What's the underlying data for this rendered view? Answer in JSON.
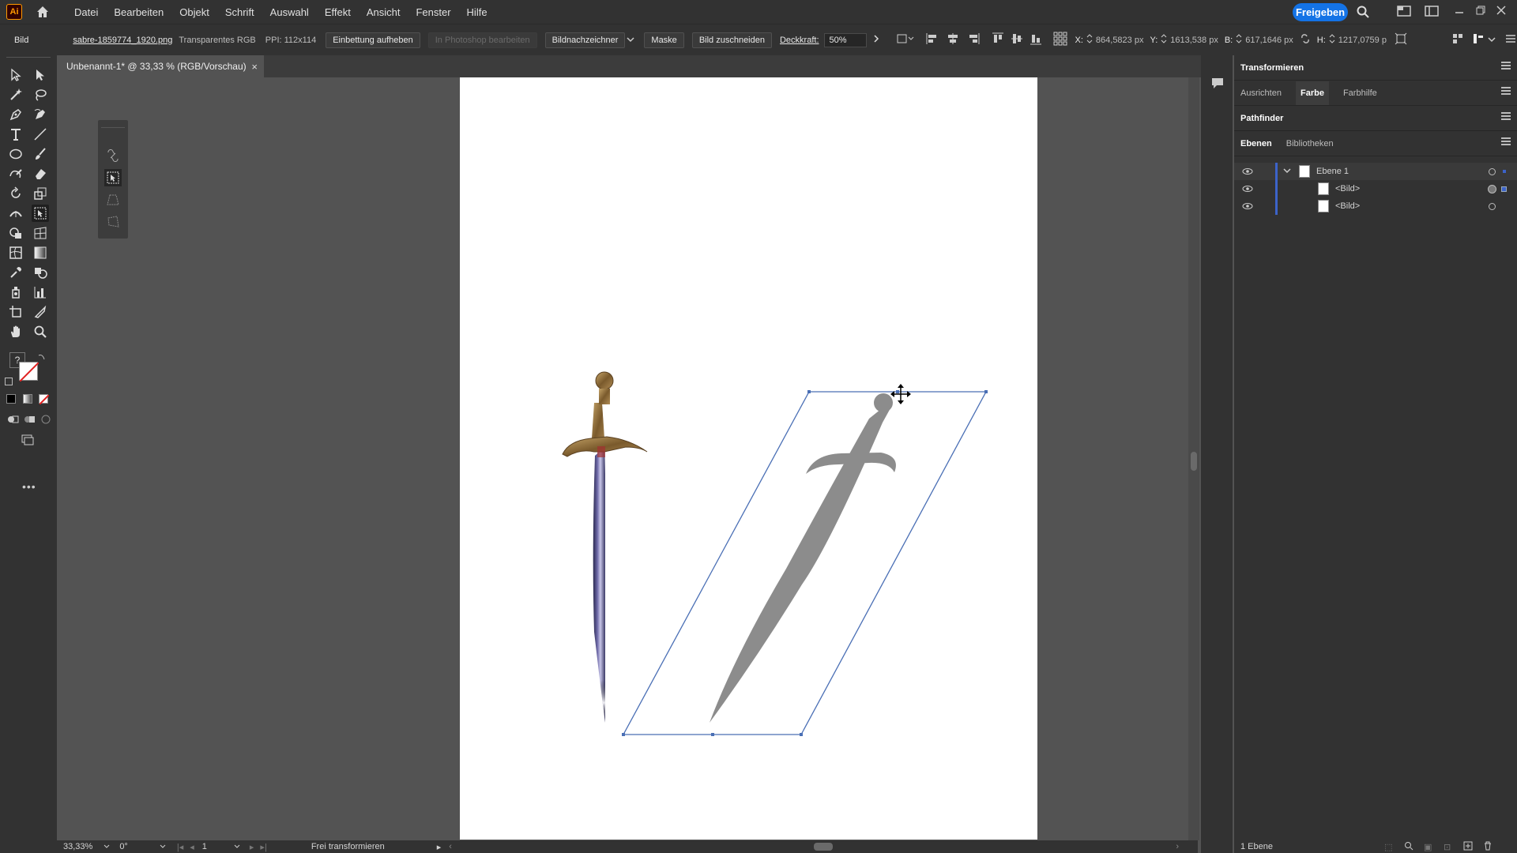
{
  "app": {
    "logo": "Ai"
  },
  "menu": [
    "Datei",
    "Bearbeiten",
    "Objekt",
    "Schrift",
    "Auswahl",
    "Effekt",
    "Ansicht",
    "Fenster",
    "Hilfe"
  ],
  "share_label": "Freigeben",
  "control": {
    "object_type": "Bild",
    "filename": "sabre-1859774_1920.png",
    "color_mode": "Transparentes RGB",
    "ppi": "PPI: 112x114",
    "unembed": "Einbettung aufheben",
    "edit_photoshop": "In Photoshop bearbeiten",
    "image_trace": "Bildnachzeichner",
    "mask": "Maske",
    "crop": "Bild zuschneiden",
    "opacity_label": "Deckkraft:",
    "opacity_value": "50%",
    "x_label": "X:",
    "x_value": "864,5823 px",
    "y_label": "Y:",
    "y_value": "1613,538 px",
    "w_label": "B:",
    "w_value": "617,1646 px",
    "h_label": "H:",
    "h_value": "1217,0759 p"
  },
  "document": {
    "tab_title": "Unbenannt-1* @ 33,33 % (RGB/Vorschau)",
    "close": "×"
  },
  "status": {
    "zoom": "33,33%",
    "rotation": "0°",
    "artboard": "1",
    "tool": "Frei transformieren"
  },
  "panels": {
    "transform_title": "Transformieren",
    "row2_tabs": [
      "Ausrichten",
      "Farbe",
      "Farbhilfe"
    ],
    "pathfinder": "Pathfinder",
    "layers_tabs": [
      "Ebenen",
      "Bibliotheken"
    ],
    "layers": [
      {
        "name": "Ebene 1"
      },
      {
        "name": "<Bild>"
      },
      {
        "name": "<Bild>"
      }
    ],
    "footer": "1 Ebene"
  },
  "colors": {
    "accent": "#1473e6",
    "selection": "#4a6fb5",
    "layer_blue": "#3c63c9"
  }
}
